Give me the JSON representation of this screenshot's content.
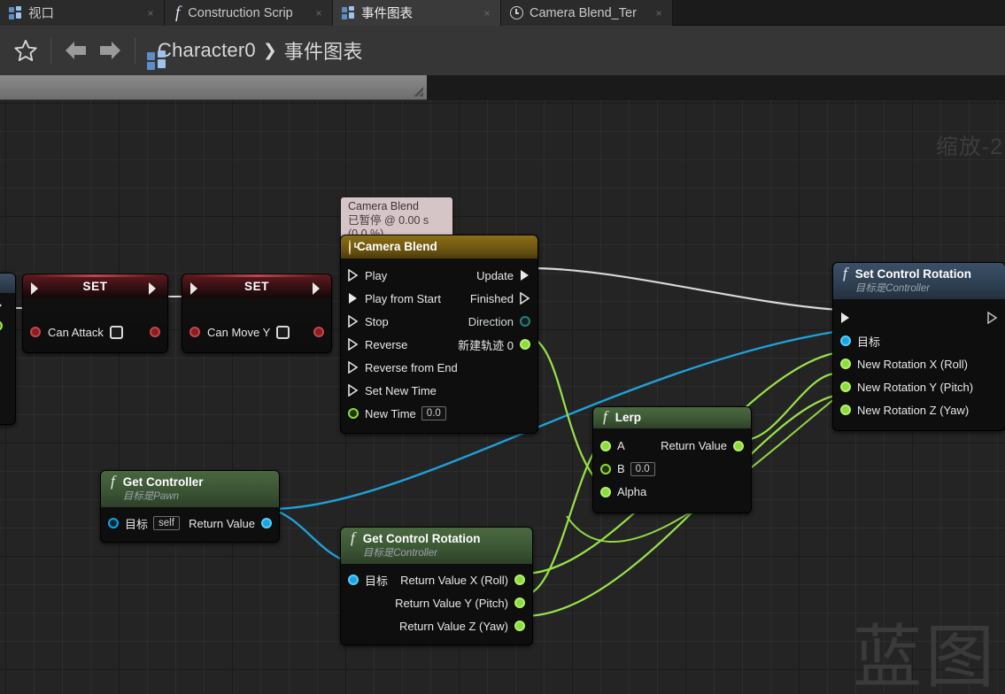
{
  "window": {
    "zoom_label": "缩放-2",
    "watermark": "蓝图"
  },
  "tabs": [
    {
      "label": "视口",
      "icon": "blueprint-grid-icon",
      "active": false,
      "close": "×"
    },
    {
      "label": "Construction Scrip",
      "icon": "function-fx-icon",
      "active": false,
      "close": "×"
    },
    {
      "label": "事件图表",
      "icon": "blueprint-grid-icon",
      "active": true,
      "close": "×"
    },
    {
      "label": "Camera Blend_Ter",
      "icon": "clock-icon",
      "active": false,
      "close": "×"
    }
  ],
  "toolbar": {
    "favorite_icon": "star-icon",
    "back_icon": "arrow-left-icon",
    "forward_icon": "arrow-right-icon",
    "breadcrumb_icon": "blueprint-grid-icon",
    "breadcrumb": [
      "Character0",
      "事件图表"
    ],
    "breadcrumb_sep": "❯"
  },
  "tooltip": {
    "title": "Camera Blend",
    "status": "已暂停 @ 0.00 s (0.0 %)"
  },
  "nodes": {
    "set_can_attack": {
      "title": "SET",
      "pin_label": "Can Attack",
      "value": ""
    },
    "set_can_move_y": {
      "title": "SET",
      "pin_label": "Can Move Y",
      "value": ""
    },
    "camera_blend": {
      "title": "Camera Blend",
      "icon": "clock-icon",
      "inputs": [
        "Play",
        "Play from Start",
        "Stop",
        "Reverse",
        "Reverse from End",
        "Set New Time"
      ],
      "input_data_label": "New Time",
      "input_data_value": "0.0",
      "outputs": [
        "Update",
        "Finished",
        "Direction"
      ],
      "track_label": "新建轨迹 0"
    },
    "get_controller": {
      "title": "Get Controller",
      "subtitle": "目标是Pawn",
      "icon": "function-fx-icon",
      "target_label": "目标",
      "target_value": "self",
      "return_label": "Return Value"
    },
    "get_control_rotation": {
      "title": "Get Control Rotation",
      "subtitle": "目标是Controller",
      "icon": "function-fx-icon",
      "target_label": "目标",
      "outputs": [
        "Return Value X (Roll)",
        "Return Value Y (Pitch)",
        "Return Value Z (Yaw)"
      ]
    },
    "lerp": {
      "title": "Lerp",
      "icon": "function-fx-icon",
      "inputs": [
        "A",
        "B",
        "Alpha"
      ],
      "b_value": "0.0",
      "output": "Return Value"
    },
    "set_control_rotation": {
      "title": "Set Control Rotation",
      "subtitle": "目标是Controller",
      "icon": "function-fx-icon",
      "target_label": "目标",
      "inputs": [
        "New Rotation X (Roll)",
        "New Rotation Y (Pitch)",
        "New Rotation Z (Yaw)"
      ]
    }
  },
  "colors": {
    "exec_wire": "#d8d8d8",
    "object_wire": "#1fa0d8",
    "float_wire": "#9ae24a",
    "bool_pin": "#8a1d1d",
    "object_pin": "#0ea5e9",
    "canvas": "#242424",
    "timeline_header": "#6b5410"
  }
}
